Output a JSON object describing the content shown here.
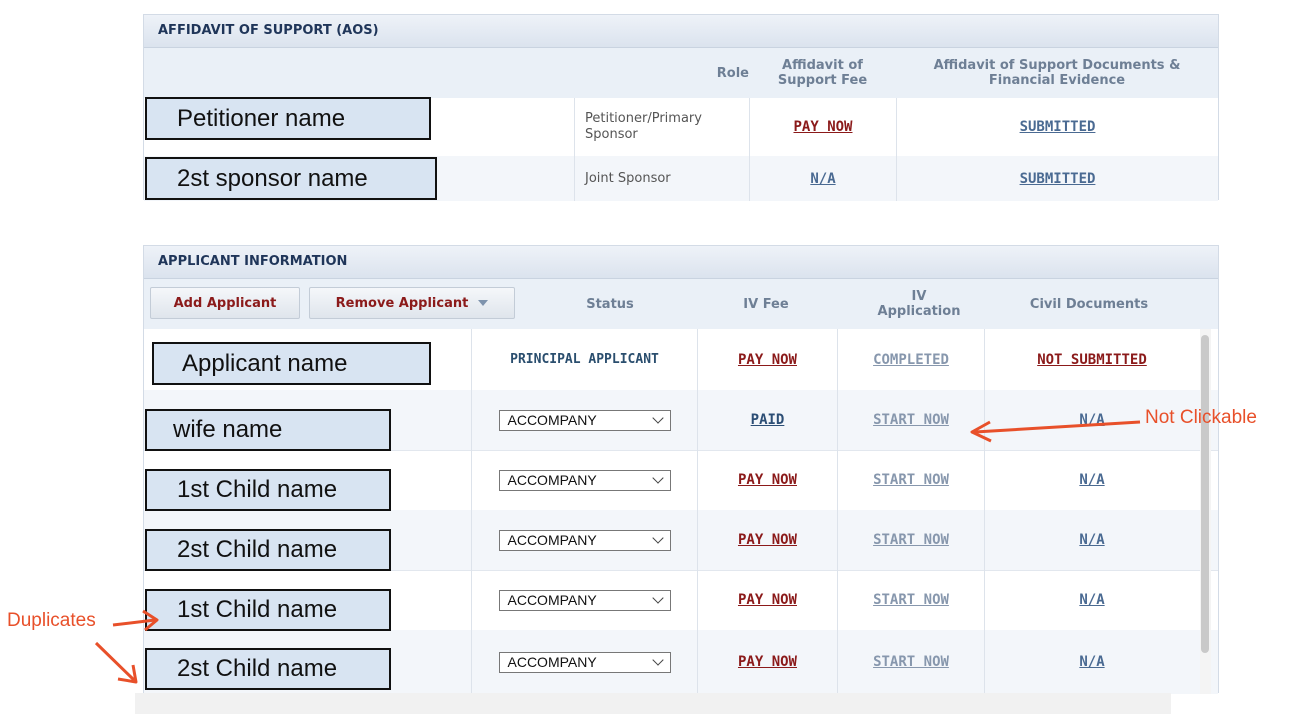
{
  "aos": {
    "title": "AFFIDAVIT OF SUPPORT (AOS)",
    "headers": {
      "role": "Role",
      "fee": "Affidavit of Support Fee",
      "docs": "Affidavit of Support Documents & Financial Evidence"
    },
    "rows": [
      {
        "name": "Petitioner name",
        "role": "Petitioner/Primary Sponsor",
        "fee": "PAY NOW",
        "docs": "SUBMITTED"
      },
      {
        "name": "2st sponsor name",
        "role": "Joint Sponsor",
        "fee": "N/A",
        "docs": "SUBMITTED"
      }
    ]
  },
  "applicants": {
    "title": "APPLICANT INFORMATION",
    "add_label": "Add Applicant",
    "remove_label": "Remove Applicant",
    "headers": {
      "status": "Status",
      "iv_fee": "IV Fee",
      "iv_app": "IV Application",
      "civil": "Civil Documents"
    },
    "rows": [
      {
        "name": "Applicant name",
        "status": "PRINCIPAL APPLICANT",
        "iv_fee": "PAY NOW",
        "iv_app": "COMPLETED",
        "civil": "NOT SUBMITTED"
      },
      {
        "name": "wife name",
        "status": "ACCOMPANY",
        "iv_fee": "PAID",
        "iv_app": "START NOW",
        "civil": "N/A"
      },
      {
        "name": "1st Child name",
        "status": "ACCOMPANY",
        "iv_fee": "PAY NOW",
        "iv_app": "START NOW",
        "civil": "N/A"
      },
      {
        "name": "2st Child name",
        "status": "ACCOMPANY",
        "iv_fee": "PAY NOW",
        "iv_app": "START NOW",
        "civil": "N/A"
      },
      {
        "name": "1st Child name",
        "status": "ACCOMPANY",
        "iv_fee": "PAY NOW",
        "iv_app": "START NOW",
        "civil": "N/A"
      },
      {
        "name": "2st Child name",
        "status": "ACCOMPANY",
        "iv_fee": "PAY NOW",
        "iv_app": "START NOW",
        "civil": "N/A"
      }
    ]
  },
  "annotations": {
    "not_clickable": "Not Clickable",
    "duplicates": "Duplicates"
  },
  "colors": {
    "link_red": "#8b1a1a",
    "link_blue": "#4a6a92",
    "annotation": "#e8502a",
    "header_text": "#1f3559"
  }
}
